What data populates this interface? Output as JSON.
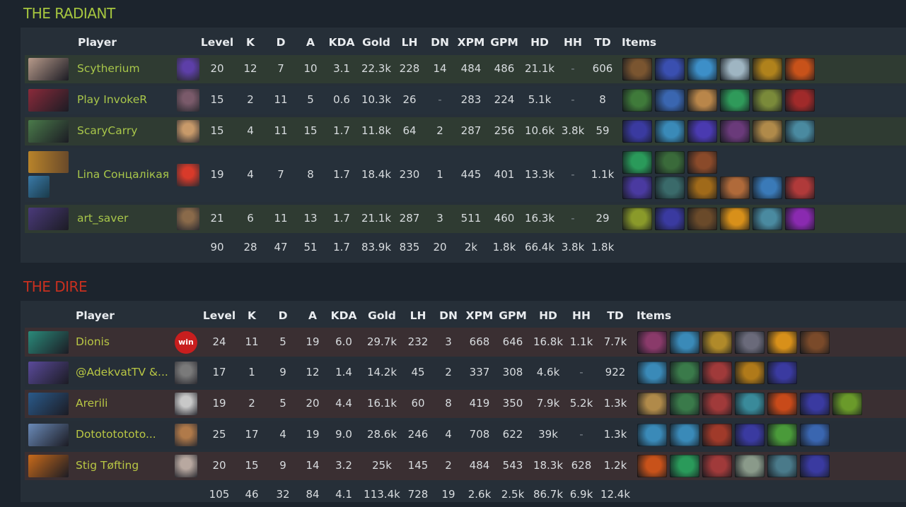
{
  "radiant": {
    "title": "THE RADIANT",
    "headers": {
      "player": "Player",
      "level": "Level",
      "k": "K",
      "d": "D",
      "a": "A",
      "kda": "KDA",
      "gold": "Gold",
      "lh": "LH",
      "dn": "DN",
      "xpm": "XPM",
      "gpm": "GPM",
      "hd": "HD",
      "hh": "HH",
      "td": "TD",
      "items": "Items"
    },
    "players": [
      {
        "name": "Scytherium",
        "level": "20",
        "k": "12",
        "d": "7",
        "a": "10",
        "kda": "3.1",
        "gold": "22.3k",
        "lh": "228",
        "dn": "14",
        "xpm": "484",
        "gpm": "486",
        "hd": "21.1k",
        "hh": "-",
        "td": "606",
        "hero_color": "#b79a8a",
        "avatar_color": "#5d3fa8",
        "items": [
          "#7a5530",
          "#3a4fb0",
          "#3d8fc8",
          "#9fb5c2",
          "#b0821c",
          "#c8521a"
        ]
      },
      {
        "name": "Play InvokeR",
        "level": "15",
        "k": "2",
        "d": "11",
        "a": "5",
        "kda": "0.6",
        "gold": "10.3k",
        "lh": "26",
        "dn": "-",
        "xpm": "283",
        "gpm": "224",
        "hd": "5.1k",
        "hh": "-",
        "td": "8",
        "hero_color": "#8a2a3a",
        "avatar_color": "#7a5a6a",
        "items": [
          "#3f7a3a",
          "#3a66b0",
          "#b9864a",
          "#2f9a5a",
          "#7a8a3a",
          "#a02a2a"
        ]
      },
      {
        "name": "ScaryCarry",
        "level": "15",
        "k": "4",
        "d": "11",
        "a": "15",
        "kda": "1.7",
        "gold": "11.8k",
        "lh": "64",
        "dn": "2",
        "xpm": "287",
        "gpm": "256",
        "hd": "10.6k",
        "hh": "3.8k",
        "td": "59",
        "hero_color": "#4a7a4a",
        "avatar_color": "#c89a6a",
        "items": [
          "#3a3aa0",
          "#3a8ab8",
          "#4a3ab0",
          "#6a3a7a",
          "#b08a4a",
          "#4a8aa0"
        ]
      },
      {
        "name": "Lina Сонцалікая",
        "level": "19",
        "k": "4",
        "d": "7",
        "a": "8",
        "kda": "1.7",
        "gold": "18.4k",
        "lh": "230",
        "dn": "1",
        "xpm": "445",
        "gpm": "401",
        "hd": "13.3k",
        "hh": "-",
        "td": "1.1k",
        "hero_color": "#b8832a",
        "hero2_color": "#3a7aa8",
        "avatar_color": "#d83a2a",
        "items": [
          "#2a9a5a",
          "#3a6a3a",
          "#8a4a2a",
          "#4a3aa0",
          "#3a6a6a",
          "#a06a1a",
          "#b06a3a",
          "#3a7ab8",
          "#b03a3a"
        ]
      },
      {
        "name": "art_saver",
        "level": "21",
        "k": "6",
        "d": "11",
        "a": "13",
        "kda": "1.7",
        "gold": "21.1k",
        "lh": "287",
        "dn": "3",
        "xpm": "511",
        "gpm": "460",
        "hd": "16.3k",
        "hh": "-",
        "td": "29",
        "hero_color": "#4a3a7a",
        "avatar_color": "#8a6a4a",
        "items": [
          "#8a9a2a",
          "#3a3aa0",
          "#6a4a2a",
          "#d8901a",
          "#4a8aa0",
          "#8a2ab0"
        ]
      }
    ],
    "totals": {
      "level": "90",
      "k": "28",
      "d": "47",
      "a": "51",
      "kda": "1.7",
      "gold": "83.9k",
      "lh": "835",
      "dn": "20",
      "xpm": "2k",
      "gpm": "1.8k",
      "hd": "66.4k",
      "hh": "3.8k",
      "td": "1.8k"
    }
  },
  "dire": {
    "title": "THE DIRE",
    "headers": {
      "player": "Player",
      "level": "Level",
      "k": "K",
      "d": "D",
      "a": "A",
      "kda": "KDA",
      "gold": "Gold",
      "lh": "LH",
      "dn": "DN",
      "xpm": "XPM",
      "gpm": "GPM",
      "hd": "HD",
      "hh": "HH",
      "td": "TD",
      "items": "Items"
    },
    "players": [
      {
        "name": "Dionis",
        "level": "24",
        "k": "11",
        "d": "5",
        "a": "19",
        "kda": "6.0",
        "gold": "29.7k",
        "lh": "232",
        "dn": "3",
        "xpm": "668",
        "gpm": "646",
        "hd": "16.8k",
        "hh": "1.1k",
        "td": "7.7k",
        "hero_color": "#2a8a7a",
        "avatar_color": "#c81e1e",
        "avatar_text": "win",
        "items": [
          "#8a3a6a",
          "#3a8ab8",
          "#b08a2a",
          "#6a6a7a",
          "#d8901a",
          "#7a4a2a"
        ]
      },
      {
        "name": "@AdekvatTV &...",
        "level": "17",
        "k": "1",
        "d": "9",
        "a": "12",
        "kda": "1.4",
        "gold": "14.2k",
        "lh": "45",
        "dn": "2",
        "xpm": "337",
        "gpm": "308",
        "hd": "4.6k",
        "hh": "-",
        "td": "922",
        "hero_color": "#5a4a9a",
        "avatar_color": "#7a7a7a",
        "items": [
          "#3a8ab8",
          "#3a7a4a",
          "#a03a3a",
          "#b07a1a",
          "#3a3aa0"
        ]
      },
      {
        "name": "Arerili",
        "level": "19",
        "k": "2",
        "d": "5",
        "a": "20",
        "kda": "4.4",
        "gold": "16.1k",
        "lh": "60",
        "dn": "8",
        "xpm": "419",
        "gpm": "350",
        "hd": "7.9k",
        "hh": "5.2k",
        "td": "1.3k",
        "hero_color": "#2a5a8a",
        "avatar_color": "#c8c8c8",
        "items": [
          "#b08a4a",
          "#3a7a4a",
          "#a03a3a",
          "#3a8a9a",
          "#c84a1a",
          "#3a3aa0",
          "#6a9a2a"
        ]
      },
      {
        "name": "Dotototototo...",
        "level": "25",
        "k": "17",
        "d": "4",
        "a": "19",
        "kda": "9.0",
        "gold": "28.6k",
        "lh": "246",
        "dn": "4",
        "xpm": "708",
        "gpm": "622",
        "hd": "39k",
        "hh": "-",
        "td": "1.3k",
        "hero_color": "#6a8ab8",
        "avatar_color": "#b07a4a",
        "items": [
          "#3a8ab8",
          "#3a8ab8",
          "#a03a2a",
          "#3a3aa0",
          "#4a9a3a",
          "#3a66b0"
        ]
      },
      {
        "name": "Stig Tøfting",
        "level": "20",
        "k": "15",
        "d": "9",
        "a": "14",
        "kda": "3.2",
        "gold": "25k",
        "lh": "145",
        "dn": "2",
        "xpm": "484",
        "gpm": "543",
        "hd": "18.3k",
        "hh": "628",
        "td": "1.2k",
        "hero_color": "#c86a1a",
        "avatar_color": "#b8a8a0",
        "items": [
          "#c8521a",
          "#2a9a5a",
          "#a03a3a",
          "#8a9a8a",
          "#4a7a8a",
          "#3a3aa0"
        ]
      }
    ],
    "totals": {
      "level": "105",
      "k": "46",
      "d": "32",
      "a": "84",
      "kda": "4.1",
      "gold": "113.4k",
      "lh": "728",
      "dn": "19",
      "xpm": "2.6k",
      "gpm": "2.5k",
      "hd": "86.7k",
      "hh": "6.9k",
      "td": "12.4k"
    }
  }
}
